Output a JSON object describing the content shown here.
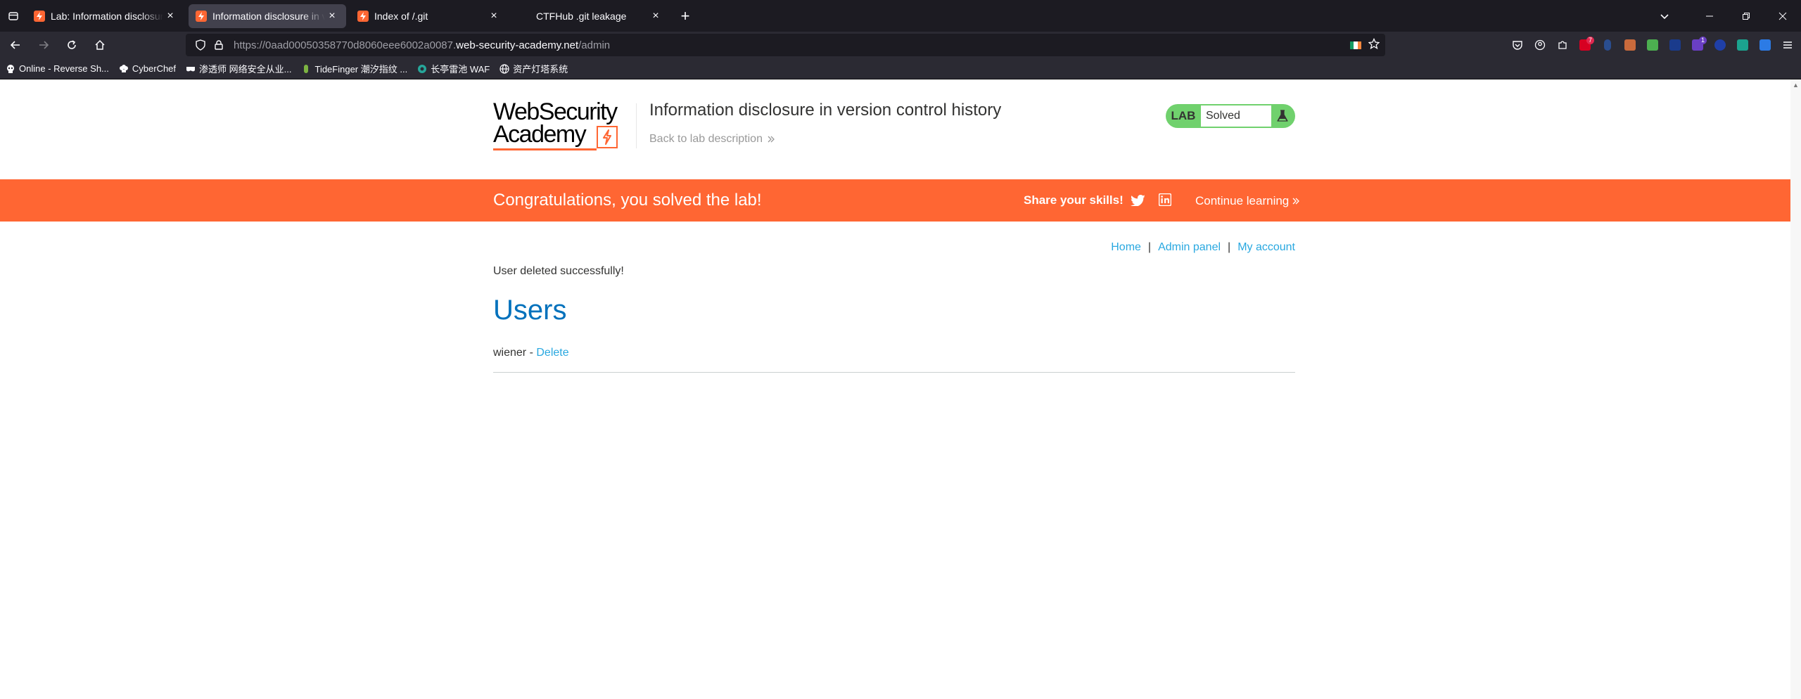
{
  "browser": {
    "tabs": [
      {
        "title": "Lab: Information disclosure in version control history",
        "active": false
      },
      {
        "title": "Information disclosure in version control history",
        "active": true
      },
      {
        "title": "Index of /.git",
        "active": false
      },
      {
        "title": "CTFHub .git leakage",
        "active": false
      }
    ],
    "url": {
      "prefix": "https://0aad00050358770d8060eee6002a0087.",
      "host": "web-security-academy.net",
      "path": "/admin"
    },
    "bookmarks": [
      "Online - Reverse Sh...",
      "CyberChef",
      "渗透师 网络安全从业...",
      "TideFinger 潮汐指纹 ...",
      "长亭雷池 WAF",
      "资产灯塔系统"
    ],
    "extension_badges": {
      "first": "7",
      "second": "1"
    }
  },
  "header": {
    "logo_line1": "WebSecurity",
    "logo_line2": "Academy",
    "lab_title": "Information disclosure in version control history",
    "back_link": "Back to lab description",
    "lab_badge": "LAB",
    "lab_status": "Solved"
  },
  "banner": {
    "message": "Congratulations, you solved the lab!",
    "share": "Share your skills!",
    "continue": "Continue learning"
  },
  "nav": {
    "home": "Home",
    "admin_panel": "Admin panel",
    "my_account": "My account",
    "separator": "|"
  },
  "main": {
    "flash": "User deleted successfully!",
    "heading": "Users",
    "users": [
      {
        "name": "wiener",
        "separator": "-",
        "action": "Delete"
      }
    ]
  },
  "colors": {
    "accent_orange": "#ff6633",
    "link_blue": "#29a8e0",
    "heading_blue": "#0071bc",
    "solved_green": "#70d16d"
  }
}
